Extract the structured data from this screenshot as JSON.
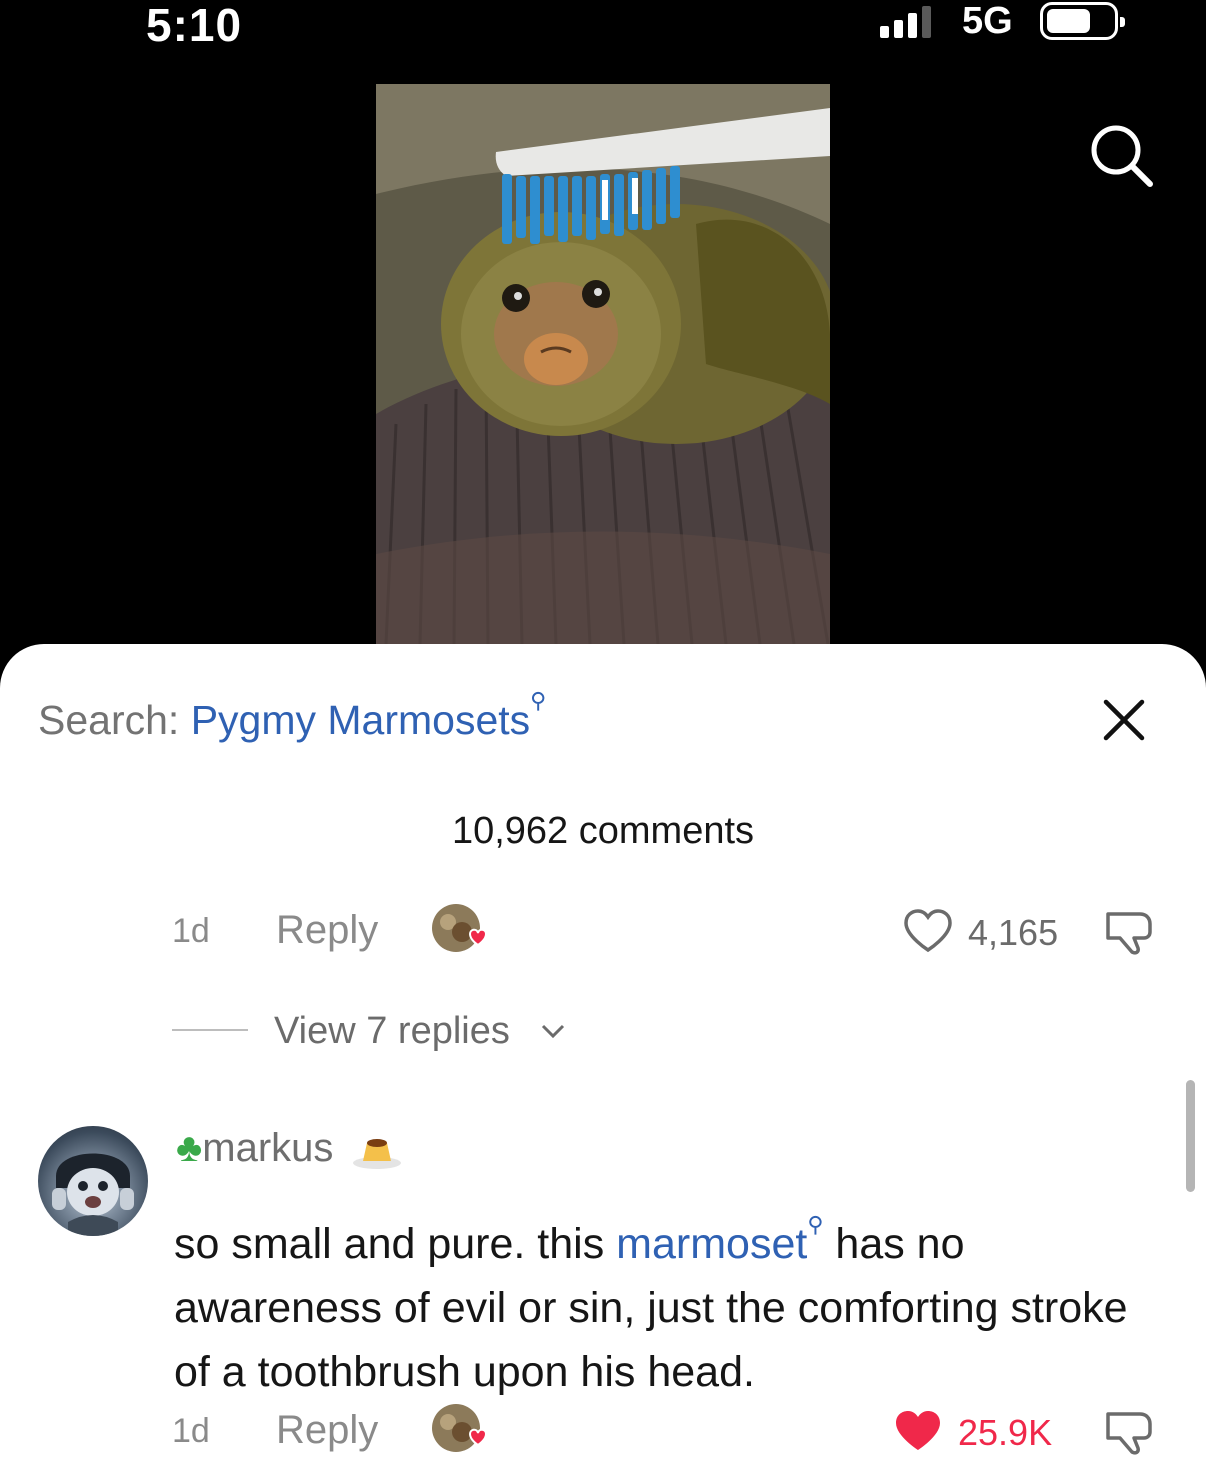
{
  "status_bar": {
    "time": "5:10",
    "network": "5G"
  },
  "sheet": {
    "search_prefix": "Search: ",
    "search_term": "Pygmy Marmosets",
    "comment_count": "10,962 comments"
  },
  "comments": [
    {
      "time": "1d",
      "reply_label": "Reply",
      "likes": "4,165",
      "liked": false
    },
    {
      "username": "markus",
      "text_before": "so small and pure. this ",
      "text_link": "marmoset",
      "text_after": " has no awareness of evil or sin, just the comforting stroke of a toothbrush upon his head.",
      "time": "1d",
      "reply_label": "Reply",
      "likes": "25.9K",
      "liked": true
    }
  ],
  "view_replies": "View 7 replies",
  "icons": {
    "search": "search-icon",
    "close": "close-icon",
    "like": "heart-icon",
    "dislike": "thumbs-down-icon",
    "chevron": "chevron-down-icon",
    "clover": "four-leaf-clover-icon",
    "pudding": "custard-pudding-icon"
  },
  "colors": {
    "link": "#2f61b3",
    "liked": "#f0284a",
    "muted": "#8a8a8a"
  }
}
